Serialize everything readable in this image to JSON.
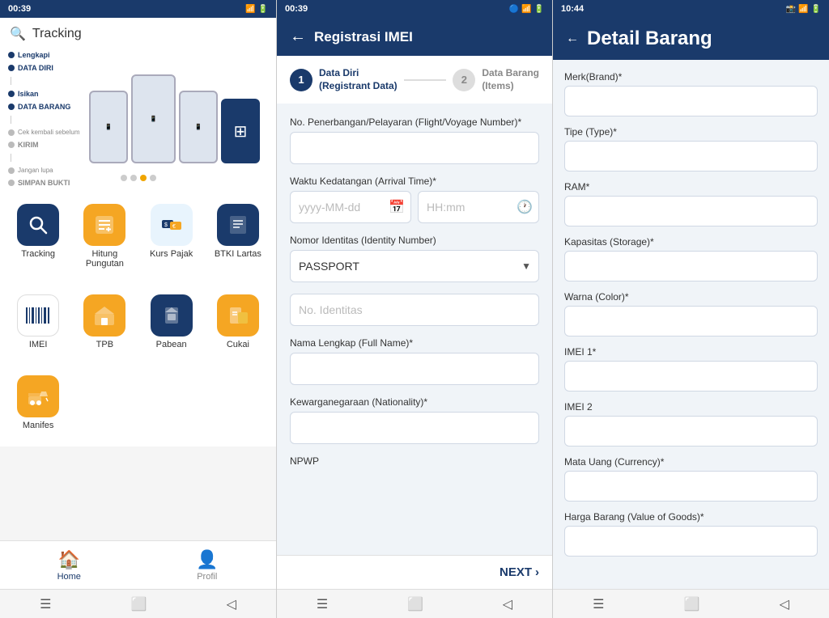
{
  "panel1": {
    "statusBar": {
      "time": "00:39",
      "icons": "🔵 📶 🔋"
    },
    "search": {
      "placeholder": "Tracking",
      "value": "Tracking"
    },
    "bannerSteps": [
      {
        "label": "Lengkapi DATA DIRI"
      },
      {
        "label": "Isikan DATA BARANG"
      },
      {
        "label": "Cek kembali sebelum KIRIM"
      },
      {
        "label": "Jangan lupa SIMPAN BUKTI"
      }
    ],
    "menuRow1": [
      {
        "label": "Tracking",
        "icon": "🔍",
        "style": "blue"
      },
      {
        "label": "Hitung Pungutan",
        "icon": "🧮",
        "style": "yellow"
      },
      {
        "label": "Kurs Pajak",
        "icon": "💱",
        "style": "light-blue"
      },
      {
        "label": "BTKI Lartas",
        "icon": "📘",
        "style": "dark-blue"
      }
    ],
    "menuRow2": [
      {
        "label": "IMEI",
        "icon": "▦",
        "style": "barcode"
      },
      {
        "label": "TPB",
        "icon": "🏭",
        "style": "yellow"
      },
      {
        "label": "Pabean",
        "icon": "📦",
        "style": "blue"
      },
      {
        "label": "Cukai",
        "icon": "🏷️",
        "style": "yellow"
      }
    ],
    "menuRow3": [
      {
        "label": "Manifes",
        "icon": "🚚",
        "style": "yellow"
      }
    ],
    "bottomNav": [
      {
        "label": "Home",
        "icon": "🏠",
        "active": true
      },
      {
        "label": "Profil",
        "icon": "👤",
        "active": false
      }
    ]
  },
  "panel2": {
    "statusBar": {
      "time": "00:39"
    },
    "header": {
      "title": "Registrasi IMEI",
      "backLabel": "←"
    },
    "steps": [
      {
        "number": "1",
        "line1": "Data Diri",
        "line2": "(Registrant Data)",
        "active": true
      },
      {
        "number": "2",
        "line1": "Data Barang",
        "line2": "(Items)",
        "active": false
      }
    ],
    "form": {
      "fields": [
        {
          "id": "flight",
          "label": "No. Penerbangan/Pelayaran (Flight/Voyage Number)*",
          "type": "text",
          "placeholder": ""
        },
        {
          "id": "arrival-date",
          "label": "Waktu Kedatangan (Arrival Time)*",
          "type": "date",
          "placeholder": "yyyy-MM-dd"
        },
        {
          "id": "arrival-time",
          "label": "",
          "type": "time",
          "placeholder": "HH:mm"
        },
        {
          "id": "identity-type",
          "label": "Nomor Identitas (Identity Number)",
          "type": "select",
          "value": "PASSPORT"
        },
        {
          "id": "identity-number",
          "label": "",
          "type": "text",
          "placeholder": "No. Identitas"
        },
        {
          "id": "full-name",
          "label": "Nama Lengkap (Full Name)*",
          "type": "text",
          "placeholder": ""
        },
        {
          "id": "nationality",
          "label": "Kewarganegaraan (Nationality)*",
          "type": "text",
          "placeholder": ""
        },
        {
          "id": "npwp",
          "label": "NPWP",
          "type": "text",
          "placeholder": ""
        }
      ]
    },
    "nextButton": "NEXT"
  },
  "panel3": {
    "statusBar": {
      "time": "10:44"
    },
    "header": {
      "title": "Detail Barang",
      "backLabel": "←"
    },
    "fields": [
      {
        "label": "Merk(Brand)*",
        "placeholder": ""
      },
      {
        "label": "Tipe (Type)*",
        "placeholder": ""
      },
      {
        "label": "RAM*",
        "placeholder": ""
      },
      {
        "label": "Kapasitas (Storage)*",
        "placeholder": ""
      },
      {
        "label": "Warna (Color)*",
        "placeholder": ""
      },
      {
        "label": "IMEI 1*",
        "placeholder": ""
      },
      {
        "label": "IMEI 2",
        "placeholder": ""
      },
      {
        "label": "Mata Uang (Currency)*",
        "placeholder": ""
      },
      {
        "label": "Harga Barang (Value of Goods)*",
        "placeholder": ""
      }
    ]
  }
}
